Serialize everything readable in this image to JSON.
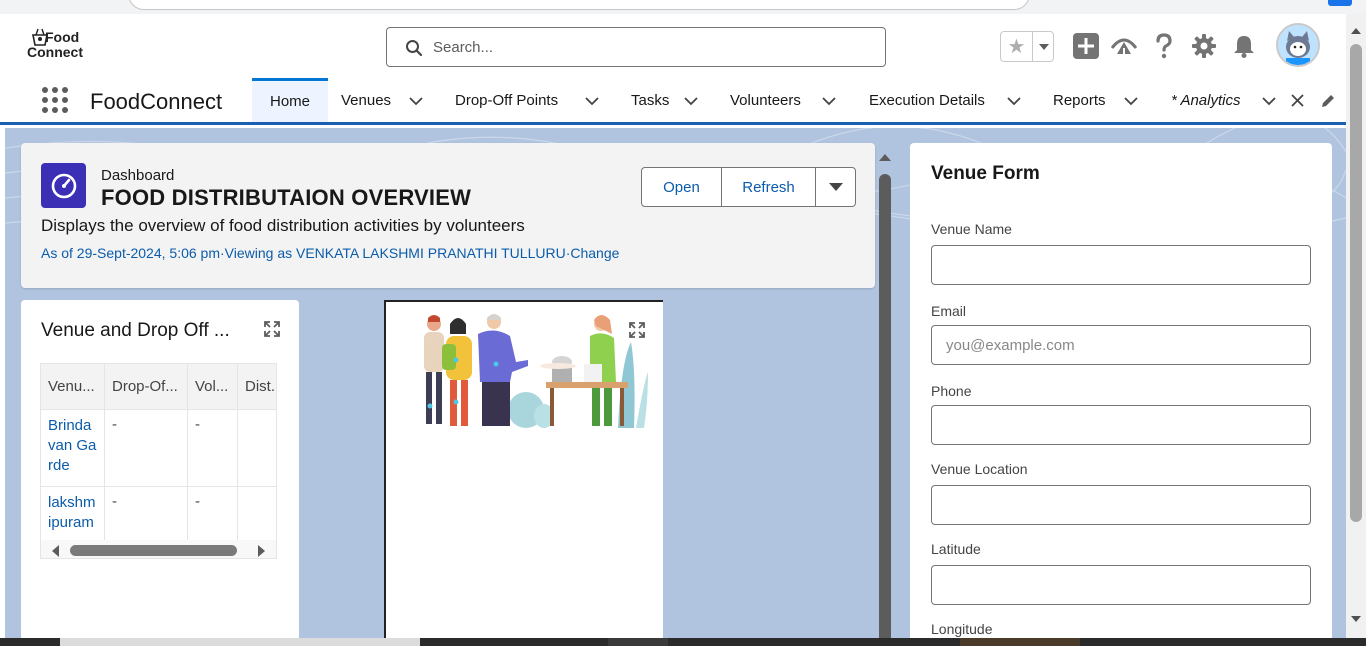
{
  "header": {
    "logo_line1": "Food",
    "logo_line2": "Connect",
    "search_placeholder": "Search..."
  },
  "nav": {
    "app_name": "FoodConnect",
    "items": [
      {
        "label": "Home"
      },
      {
        "label": "Venues"
      },
      {
        "label": "Drop-Off Points"
      },
      {
        "label": "Tasks"
      },
      {
        "label": "Volunteers"
      },
      {
        "label": "Execution Details"
      },
      {
        "label": "Reports"
      },
      {
        "label": "* Analytics"
      }
    ]
  },
  "dashboard": {
    "kicker": "Dashboard",
    "title": "FOOD DISTRIBUTAION OVERVIEW",
    "description": "Displays the overview of food distribution activities by volunteers",
    "meta": "As of 29-Sept-2024, 5:06 pm·Viewing as VENKATA LAKSHMI PRANATHI TULLURU·Change",
    "open_label": "Open",
    "refresh_label": "Refresh"
  },
  "table_widget": {
    "title": "Venue and Drop Off ...",
    "columns": [
      "Venu...",
      "Drop-Of...",
      "Vol...",
      "Dist..."
    ],
    "rows": [
      {
        "venue": "Brinda van Garde",
        "dropoff": "-",
        "vol": "-",
        "dist": ""
      },
      {
        "venue": "lakshm ipuram",
        "dropoff": "-",
        "vol": "-",
        "dist": ""
      }
    ]
  },
  "form": {
    "title": "Venue Form",
    "fields": [
      {
        "label": "Venue Name",
        "value": "",
        "placeholder": ""
      },
      {
        "label": "Email",
        "value": "",
        "placeholder": "you@example.com"
      },
      {
        "label": "Phone",
        "value": "",
        "placeholder": ""
      },
      {
        "label": "Venue Location",
        "value": "",
        "placeholder": ""
      },
      {
        "label": "Latitude",
        "value": "",
        "placeholder": ""
      },
      {
        "label": "Longitude",
        "value": "",
        "placeholder": ""
      }
    ]
  },
  "colors": {
    "brand_blue": "#0176d3",
    "link_blue": "#0b5cab",
    "dashboard_icon": "#3a2fb5",
    "content_bg": "#b0c4df"
  }
}
